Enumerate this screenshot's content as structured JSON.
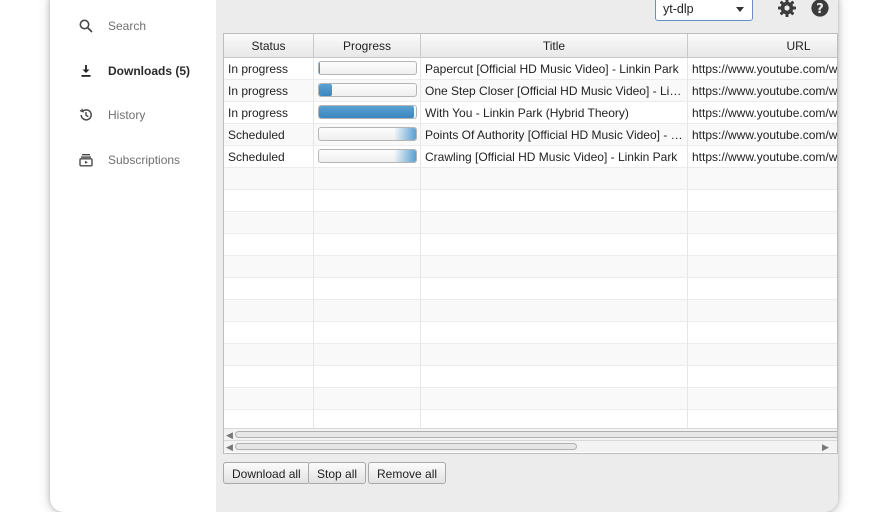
{
  "sidebar": {
    "items": [
      {
        "label": "Search",
        "icon": "search-icon"
      },
      {
        "label": "Downloads (5)",
        "icon": "download-icon"
      },
      {
        "label": "History",
        "icon": "history-icon"
      },
      {
        "label": "Subscriptions",
        "icon": "subscriptions-icon"
      }
    ]
  },
  "toolbar": {
    "engine_selected": "yt-dlp",
    "settings_icon": "gear-icon",
    "help_icon": "help-icon"
  },
  "table": {
    "columns": [
      "Status",
      "Progress",
      "Title",
      "URL"
    ],
    "rows": [
      {
        "status": "In progress",
        "progress": 0.01,
        "progress_state": "determinate",
        "title": "Papercut [Official HD Music Video] - Linkin Park",
        "url": "https://www.youtube.com/wa"
      },
      {
        "status": "In progress",
        "progress": 0.13,
        "progress_state": "determinate",
        "title": "One Step Closer [Official HD Music Video] - Linkin P...",
        "url": "https://www.youtube.com/wa"
      },
      {
        "status": "In progress",
        "progress": 0.98,
        "progress_state": "determinate",
        "title": "With You - Linkin Park (Hybrid Theory)",
        "url": "https://www.youtube.com/wa"
      },
      {
        "status": "Scheduled",
        "progress": null,
        "progress_state": "indeterminate",
        "title": "Points Of Authority [Official HD Music Video] - Linki...",
        "url": "https://www.youtube.com/wa"
      },
      {
        "status": "Scheduled",
        "progress": null,
        "progress_state": "indeterminate",
        "title": "Crawling [Official HD Music Video] - Linkin Park",
        "url": "https://www.youtube.com/wa"
      }
    ]
  },
  "footer": {
    "download_all": "Download all",
    "stop_all": "Stop all",
    "remove_all": "Remove all"
  },
  "colors": {
    "accent": "#3a86bf",
    "main_bg": "#ececec"
  }
}
